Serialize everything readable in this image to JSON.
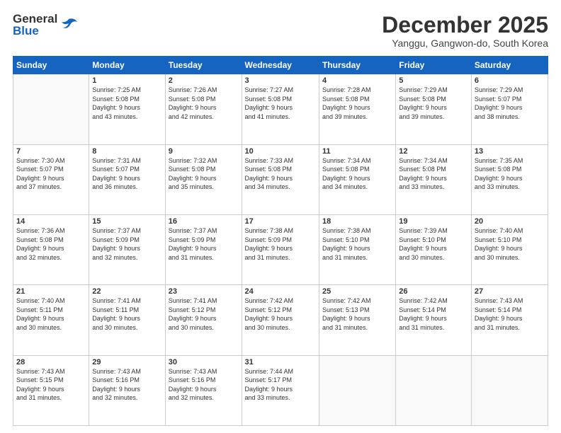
{
  "header": {
    "logo_general": "General",
    "logo_blue": "Blue",
    "title": "December 2025",
    "location": "Yanggu, Gangwon-do, South Korea"
  },
  "days_of_week": [
    "Sunday",
    "Monday",
    "Tuesday",
    "Wednesday",
    "Thursday",
    "Friday",
    "Saturday"
  ],
  "weeks": [
    [
      {
        "day": "",
        "info": ""
      },
      {
        "day": "1",
        "info": "Sunrise: 7:25 AM\nSunset: 5:08 PM\nDaylight: 9 hours\nand 43 minutes."
      },
      {
        "day": "2",
        "info": "Sunrise: 7:26 AM\nSunset: 5:08 PM\nDaylight: 9 hours\nand 42 minutes."
      },
      {
        "day": "3",
        "info": "Sunrise: 7:27 AM\nSunset: 5:08 PM\nDaylight: 9 hours\nand 41 minutes."
      },
      {
        "day": "4",
        "info": "Sunrise: 7:28 AM\nSunset: 5:08 PM\nDaylight: 9 hours\nand 39 minutes."
      },
      {
        "day": "5",
        "info": "Sunrise: 7:29 AM\nSunset: 5:08 PM\nDaylight: 9 hours\nand 39 minutes."
      },
      {
        "day": "6",
        "info": "Sunrise: 7:29 AM\nSunset: 5:07 PM\nDaylight: 9 hours\nand 38 minutes."
      }
    ],
    [
      {
        "day": "7",
        "info": "Sunrise: 7:30 AM\nSunset: 5:07 PM\nDaylight: 9 hours\nand 37 minutes."
      },
      {
        "day": "8",
        "info": "Sunrise: 7:31 AM\nSunset: 5:07 PM\nDaylight: 9 hours\nand 36 minutes."
      },
      {
        "day": "9",
        "info": "Sunrise: 7:32 AM\nSunset: 5:08 PM\nDaylight: 9 hours\nand 35 minutes."
      },
      {
        "day": "10",
        "info": "Sunrise: 7:33 AM\nSunset: 5:08 PM\nDaylight: 9 hours\nand 34 minutes."
      },
      {
        "day": "11",
        "info": "Sunrise: 7:34 AM\nSunset: 5:08 PM\nDaylight: 9 hours\nand 34 minutes."
      },
      {
        "day": "12",
        "info": "Sunrise: 7:34 AM\nSunset: 5:08 PM\nDaylight: 9 hours\nand 33 minutes."
      },
      {
        "day": "13",
        "info": "Sunrise: 7:35 AM\nSunset: 5:08 PM\nDaylight: 9 hours\nand 33 minutes."
      }
    ],
    [
      {
        "day": "14",
        "info": "Sunrise: 7:36 AM\nSunset: 5:08 PM\nDaylight: 9 hours\nand 32 minutes."
      },
      {
        "day": "15",
        "info": "Sunrise: 7:37 AM\nSunset: 5:09 PM\nDaylight: 9 hours\nand 32 minutes."
      },
      {
        "day": "16",
        "info": "Sunrise: 7:37 AM\nSunset: 5:09 PM\nDaylight: 9 hours\nand 31 minutes."
      },
      {
        "day": "17",
        "info": "Sunrise: 7:38 AM\nSunset: 5:09 PM\nDaylight: 9 hours\nand 31 minutes."
      },
      {
        "day": "18",
        "info": "Sunrise: 7:38 AM\nSunset: 5:10 PM\nDaylight: 9 hours\nand 31 minutes."
      },
      {
        "day": "19",
        "info": "Sunrise: 7:39 AM\nSunset: 5:10 PM\nDaylight: 9 hours\nand 30 minutes."
      },
      {
        "day": "20",
        "info": "Sunrise: 7:40 AM\nSunset: 5:10 PM\nDaylight: 9 hours\nand 30 minutes."
      }
    ],
    [
      {
        "day": "21",
        "info": "Sunrise: 7:40 AM\nSunset: 5:11 PM\nDaylight: 9 hours\nand 30 minutes."
      },
      {
        "day": "22",
        "info": "Sunrise: 7:41 AM\nSunset: 5:11 PM\nDaylight: 9 hours\nand 30 minutes."
      },
      {
        "day": "23",
        "info": "Sunrise: 7:41 AM\nSunset: 5:12 PM\nDaylight: 9 hours\nand 30 minutes."
      },
      {
        "day": "24",
        "info": "Sunrise: 7:42 AM\nSunset: 5:12 PM\nDaylight: 9 hours\nand 30 minutes."
      },
      {
        "day": "25",
        "info": "Sunrise: 7:42 AM\nSunset: 5:13 PM\nDaylight: 9 hours\nand 31 minutes."
      },
      {
        "day": "26",
        "info": "Sunrise: 7:42 AM\nSunset: 5:14 PM\nDaylight: 9 hours\nand 31 minutes."
      },
      {
        "day": "27",
        "info": "Sunrise: 7:43 AM\nSunset: 5:14 PM\nDaylight: 9 hours\nand 31 minutes."
      }
    ],
    [
      {
        "day": "28",
        "info": "Sunrise: 7:43 AM\nSunset: 5:15 PM\nDaylight: 9 hours\nand 31 minutes."
      },
      {
        "day": "29",
        "info": "Sunrise: 7:43 AM\nSunset: 5:16 PM\nDaylight: 9 hours\nand 32 minutes."
      },
      {
        "day": "30",
        "info": "Sunrise: 7:43 AM\nSunset: 5:16 PM\nDaylight: 9 hours\nand 32 minutes."
      },
      {
        "day": "31",
        "info": "Sunrise: 7:44 AM\nSunset: 5:17 PM\nDaylight: 9 hours\nand 33 minutes."
      },
      {
        "day": "",
        "info": ""
      },
      {
        "day": "",
        "info": ""
      },
      {
        "day": "",
        "info": ""
      }
    ]
  ]
}
